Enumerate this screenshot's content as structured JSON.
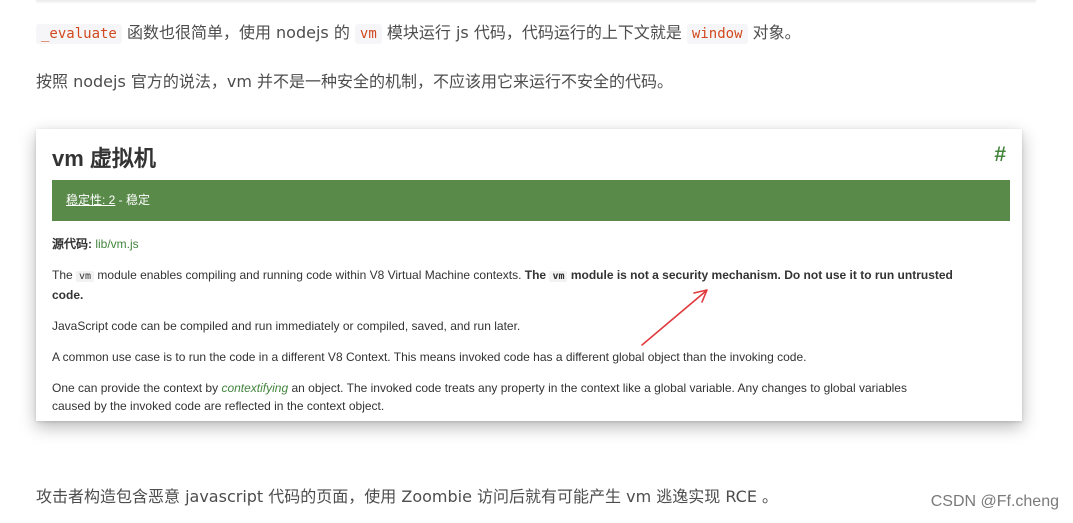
{
  "article": {
    "p1": {
      "code1": "_evaluate",
      "t1": " 函数也很简单，使用 nodejs 的 ",
      "code2": "vm",
      "t2": " 模块运行 js 代码，代码运行的上下文就是 ",
      "code3": "window",
      "t3": " 对象。"
    },
    "p2": "按照 nodejs 官方的说法，vm 并不是一种安全的机制，不应该用它来运行不安全的代码。",
    "p3": "攻击者构造包含恶意 javascript 代码的页面，使用 Zoombie 访问后就有可能产生 vm 逃逸实现 RCE 。"
  },
  "screenshot": {
    "title": "vm 虚拟机",
    "hash": "#",
    "stability": {
      "link": "稳定性: 2",
      "sep": " - ",
      "text": "稳定"
    },
    "source": {
      "label": "源代码: ",
      "link": "lib/vm.js"
    },
    "line1": {
      "a": "The ",
      "code1": "vm",
      "b": " module enables compiling and running code within V8 Virtual Machine contexts. ",
      "bold1": "The ",
      "code2": "vm",
      "bold2": " module is not a security mechanism. Do not use it to run untrusted",
      "bold3": "code."
    },
    "line2": "JavaScript code can be compiled and run immediately or compiled, saved, and run later.",
    "line3": "A common use case is to run the code in a different V8 Context. This means invoked code has a different global object than the invoking code.",
    "line4": {
      "a": "One can provide the context by ",
      "link": "contextifying",
      "b": " an object. The invoked code treats any property in the context like a global variable. Any changes to global variables",
      "c": "caused by the invoked code are reflected in the context object."
    },
    "arrow_color": "#e0393e"
  },
  "watermark": "CSDN @Ff.cheng",
  "colors": {
    "stability_bar": "#5a8a4a",
    "link_green": "#43853d",
    "inline_code": "#d14a1f"
  }
}
